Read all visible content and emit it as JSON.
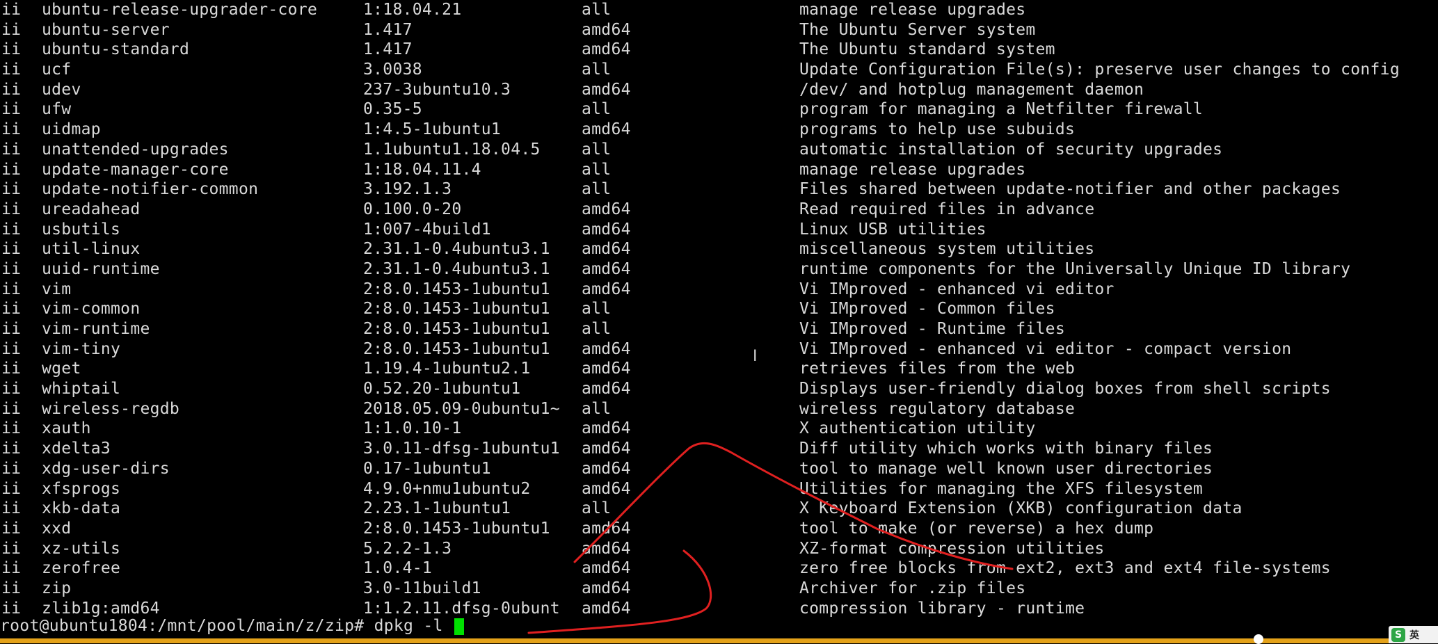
{
  "terminal": {
    "rows": [
      {
        "status": "ii",
        "name": "ubuntu-release-upgrader-core",
        "version": "1:18.04.21",
        "arch": "all",
        "description": "manage release upgrades"
      },
      {
        "status": "ii",
        "name": "ubuntu-server",
        "version": "1.417",
        "arch": "amd64",
        "description": "The Ubuntu Server system"
      },
      {
        "status": "ii",
        "name": "ubuntu-standard",
        "version": "1.417",
        "arch": "amd64",
        "description": "The Ubuntu standard system"
      },
      {
        "status": "ii",
        "name": "ucf",
        "version": "3.0038",
        "arch": "all",
        "description": "Update Configuration File(s): preserve user changes to config"
      },
      {
        "status": "ii",
        "name": "udev",
        "version": "237-3ubuntu10.3",
        "arch": "amd64",
        "description": "/dev/ and hotplug management daemon"
      },
      {
        "status": "ii",
        "name": "ufw",
        "version": "0.35-5",
        "arch": "all",
        "description": "program for managing a Netfilter firewall"
      },
      {
        "status": "ii",
        "name": "uidmap",
        "version": "1:4.5-1ubuntu1",
        "arch": "amd64",
        "description": "programs to help use subuids"
      },
      {
        "status": "ii",
        "name": "unattended-upgrades",
        "version": "1.1ubuntu1.18.04.5",
        "arch": "all",
        "description": "automatic installation of security upgrades"
      },
      {
        "status": "ii",
        "name": "update-manager-core",
        "version": "1:18.04.11.4",
        "arch": "all",
        "description": "manage release upgrades"
      },
      {
        "status": "ii",
        "name": "update-notifier-common",
        "version": "3.192.1.3",
        "arch": "all",
        "description": "Files shared between update-notifier and other packages"
      },
      {
        "status": "ii",
        "name": "ureadahead",
        "version": "0.100.0-20",
        "arch": "amd64",
        "description": "Read required files in advance"
      },
      {
        "status": "ii",
        "name": "usbutils",
        "version": "1:007-4build1",
        "arch": "amd64",
        "description": "Linux USB utilities"
      },
      {
        "status": "ii",
        "name": "util-linux",
        "version": "2.31.1-0.4ubuntu3.1",
        "arch": "amd64",
        "description": "miscellaneous system utilities"
      },
      {
        "status": "ii",
        "name": "uuid-runtime",
        "version": "2.31.1-0.4ubuntu3.1",
        "arch": "amd64",
        "description": "runtime components for the Universally Unique ID library"
      },
      {
        "status": "ii",
        "name": "vim",
        "version": "2:8.0.1453-1ubuntu1",
        "arch": "amd64",
        "description": "Vi IMproved - enhanced vi editor"
      },
      {
        "status": "ii",
        "name": "vim-common",
        "version": "2:8.0.1453-1ubuntu1",
        "arch": "all",
        "description": "Vi IMproved - Common files"
      },
      {
        "status": "ii",
        "name": "vim-runtime",
        "version": "2:8.0.1453-1ubuntu1",
        "arch": "all",
        "description": "Vi IMproved - Runtime files"
      },
      {
        "status": "ii",
        "name": "vim-tiny",
        "version": "2:8.0.1453-1ubuntu1",
        "arch": "amd64",
        "description": "Vi IMproved - enhanced vi editor - compact version"
      },
      {
        "status": "ii",
        "name": "wget",
        "version": "1.19.4-1ubuntu2.1",
        "arch": "amd64",
        "description": "retrieves files from the web"
      },
      {
        "status": "ii",
        "name": "whiptail",
        "version": "0.52.20-1ubuntu1",
        "arch": "amd64",
        "description": "Displays user-friendly dialog boxes from shell scripts"
      },
      {
        "status": "ii",
        "name": "wireless-regdb",
        "version": "2018.05.09-0ubuntu1~",
        "arch": "all",
        "description": "wireless regulatory database"
      },
      {
        "status": "ii",
        "name": "xauth",
        "version": "1:1.0.10-1",
        "arch": "amd64",
        "description": "X authentication utility"
      },
      {
        "status": "ii",
        "name": "xdelta3",
        "version": "3.0.11-dfsg-1ubuntu1",
        "arch": "amd64",
        "description": "Diff utility which works with binary files"
      },
      {
        "status": "ii",
        "name": "xdg-user-dirs",
        "version": "0.17-1ubuntu1",
        "arch": "amd64",
        "description": "tool to manage well known user directories"
      },
      {
        "status": "ii",
        "name": "xfsprogs",
        "version": "4.9.0+nmu1ubuntu2",
        "arch": "amd64",
        "description": "Utilities for managing the XFS filesystem"
      },
      {
        "status": "ii",
        "name": "xkb-data",
        "version": "2.23.1-1ubuntu1",
        "arch": "all",
        "description": "X Keyboard Extension (XKB) configuration data"
      },
      {
        "status": "ii",
        "name": "xxd",
        "version": "2:8.0.1453-1ubuntu1",
        "arch": "amd64",
        "description": "tool to make (or reverse) a hex dump"
      },
      {
        "status": "ii",
        "name": "xz-utils",
        "version": "5.2.2-1.3",
        "arch": "amd64",
        "description": "XZ-format compression utilities"
      },
      {
        "status": "ii",
        "name": "zerofree",
        "version": "1.0.4-1",
        "arch": "amd64",
        "description": "zero free blocks from ext2, ext3 and ext4 file-systems"
      },
      {
        "status": "ii",
        "name": "zip",
        "version": "3.0-11build1",
        "arch": "amd64",
        "description": "Archiver for .zip files"
      },
      {
        "status": "ii",
        "name": "zlib1g:amd64",
        "version": "1:1.2.11.dfsg-0ubunt",
        "arch": "amd64",
        "description": "compression library - runtime"
      }
    ],
    "prompt": "root@ubuntu1804:/mnt/pool/main/z/zip# dpkg -l "
  },
  "ime": {
    "logo": "S",
    "lang": "英"
  },
  "colors": {
    "background": "#000000",
    "text": "#d9d9d9",
    "cursor": "#00e000",
    "annotation": "#e02020",
    "status_bar": "#e4a21a"
  }
}
